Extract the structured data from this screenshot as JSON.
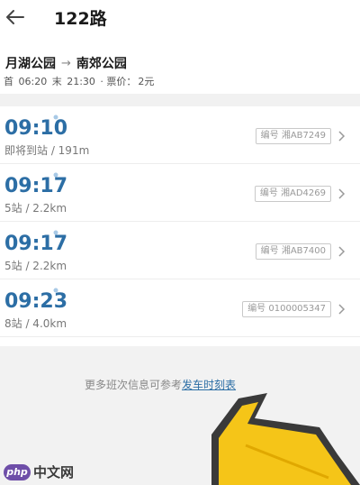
{
  "header": {
    "title": "122路",
    "back_icon": "back-arrow-icon"
  },
  "route": {
    "from": "月湖公园",
    "arrow": "→",
    "to": "南郊公园"
  },
  "schedule": {
    "first_label": "首",
    "first_time": "06:20",
    "last_label": "末",
    "last_time": "21:30",
    "fare_label": "· 票价：",
    "fare": "2元"
  },
  "buses": [
    {
      "time": "09:10",
      "info": "即将到站 / 191m",
      "plate": "编号 湘AB7249"
    },
    {
      "time": "09:17",
      "info": "5站 / 2.2km",
      "plate": "编号 湘AD4269"
    },
    {
      "time": "09:17",
      "info": "5站 / 2.2km",
      "plate": "编号 湘AB7400"
    },
    {
      "time": "09:23",
      "info": "8站 / 4.0km",
      "plate": "编号 0100005347"
    }
  ],
  "footer": {
    "more_prefix": "更多班次信息可参考",
    "more_link": "发车时刻表"
  },
  "watermark": {
    "logo": "php",
    "text": "中文网"
  },
  "colors": {
    "accent": "#2c6ea5",
    "arrow_fill": "#f5c518",
    "band": "#f1f1f1"
  }
}
